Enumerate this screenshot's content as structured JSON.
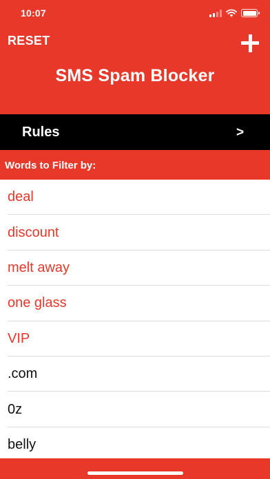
{
  "status_bar": {
    "time": "10:07"
  },
  "header": {
    "reset_label": "RESET",
    "add_icon": "plus-icon",
    "title": "SMS Spam Blocker"
  },
  "rules": {
    "label": "Rules",
    "chevron": ">"
  },
  "words_section": {
    "label": "Words to Filter by:",
    "items": [
      {
        "text": "deal",
        "highlighted": true
      },
      {
        "text": "discount",
        "highlighted": true
      },
      {
        "text": "melt away",
        "highlighted": true
      },
      {
        "text": "one glass",
        "highlighted": true
      },
      {
        "text": "VIP",
        "highlighted": true
      },
      {
        "text": ".com",
        "highlighted": false
      },
      {
        "text": "0z",
        "highlighted": false
      },
      {
        "text": "belly",
        "highlighted": false
      }
    ]
  },
  "colors": {
    "accent": "#e8382a",
    "bar": "#000000",
    "list_bg": "#ffffff",
    "plain_text": "#111111"
  }
}
